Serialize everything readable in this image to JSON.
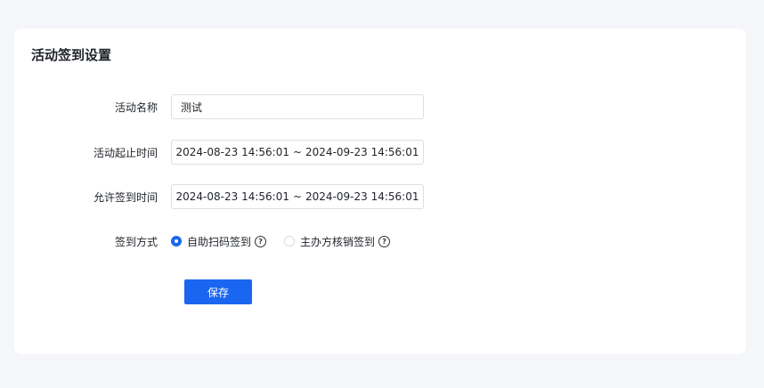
{
  "page_title": "活动签到设置",
  "form": {
    "activity_name": {
      "label": "活动名称",
      "value": "测试"
    },
    "activity_time": {
      "label": "活动起止时间",
      "start": "2024-08-23 14:56:01",
      "separator": "~",
      "end": "2024-09-23 14:56:01"
    },
    "checkin_time": {
      "label": "允许签到时间",
      "start": "2024-08-23 14:56:01",
      "separator": "~",
      "end": "2024-09-23 14:56:01"
    },
    "checkin_method": {
      "label": "签到方式",
      "options": [
        {
          "label": "自助扫码签到",
          "checked": true
        },
        {
          "label": "主办方核销签到",
          "checked": false
        }
      ]
    }
  },
  "save_label": "保存",
  "colors": {
    "primary": "#1a66f0",
    "background": "#f5f6fa"
  }
}
